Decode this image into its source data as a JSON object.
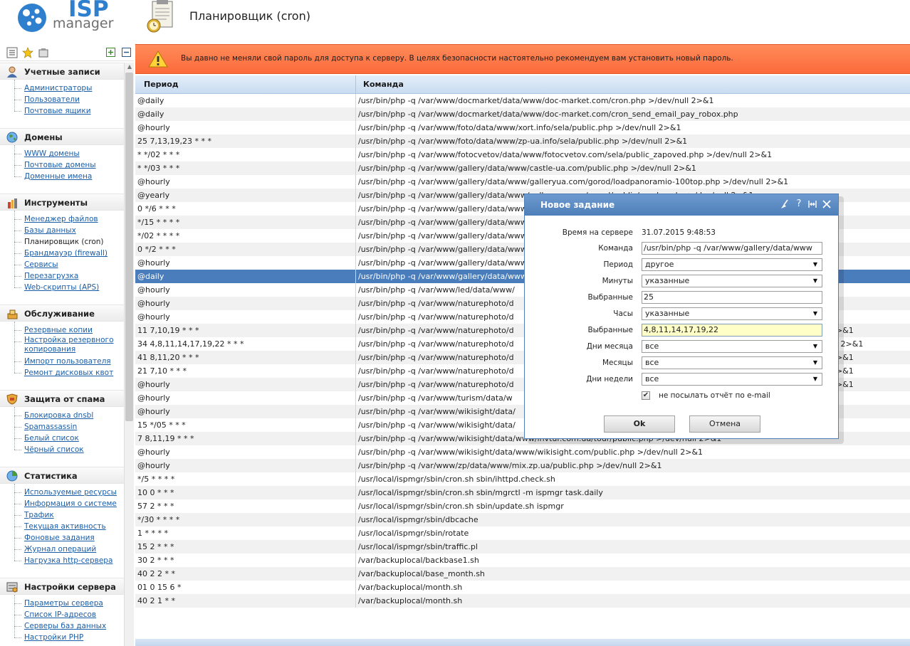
{
  "header": {
    "logo_isp": "ISP",
    "logo_manager": "manager",
    "page_title": "Планировщик (cron)"
  },
  "sidebar": {
    "toolbar": [
      "list-icon",
      "favorites-star-icon",
      "notes-icon",
      "expand-plus-icon",
      "collapse-minus-icon"
    ],
    "groups": [
      {
        "title": "Учетные записи",
        "icon": "users-icon",
        "items": [
          {
            "label": "Администраторы"
          },
          {
            "label": "Пользователи"
          },
          {
            "label": "Почтовые ящики"
          }
        ]
      },
      {
        "title": "Домены",
        "icon": "globe-icon",
        "items": [
          {
            "label": "WWW домены"
          },
          {
            "label": "Почтовые домены"
          },
          {
            "label": "Доменные имена"
          }
        ]
      },
      {
        "title": "Инструменты",
        "icon": "tools-icon",
        "items": [
          {
            "label": "Менеджер файлов"
          },
          {
            "label": "Базы данных"
          },
          {
            "label": "Планировщик (cron)"
          },
          {
            "label": "Брандмауэр (firewall)"
          },
          {
            "label": "Сервисы"
          },
          {
            "label": "Перезагрузка"
          },
          {
            "label": "Web-скрипты (APS)"
          }
        ]
      },
      {
        "title": "Обслуживание",
        "icon": "maintenance-icon",
        "items": [
          {
            "label": "Резервные копии"
          },
          {
            "label": "Настройка резервного копирования"
          },
          {
            "label": "Импорт пользователя"
          },
          {
            "label": "Ремонт дисковых квот"
          }
        ]
      },
      {
        "title": "Защита от спама",
        "icon": "shield-icon",
        "items": [
          {
            "label": "Блокировка dnsbl"
          },
          {
            "label": "Spamassassin"
          },
          {
            "label": "Белый список"
          },
          {
            "label": "Чёрный список"
          }
        ]
      },
      {
        "title": "Статистика",
        "icon": "chart-icon",
        "items": [
          {
            "label": "Используемые ресурсы"
          },
          {
            "label": "Информация о системе"
          },
          {
            "label": "Трафик"
          },
          {
            "label": "Текущая активность"
          },
          {
            "label": "Фоновые задания"
          },
          {
            "label": "Журнал операций"
          },
          {
            "label": "Нагрузка http-сервера"
          }
        ]
      },
      {
        "title": "Настройки сервера",
        "icon": "server-settings-icon",
        "items": [
          {
            "label": "Параметры сервера"
          },
          {
            "label": "Список IP-адресов"
          },
          {
            "label": "Серверы баз данных"
          },
          {
            "label": "Настройки PHP"
          }
        ]
      }
    ]
  },
  "warning": {
    "icon": "warning-icon",
    "text": "Вы давно не меняли свой пароль для доступа к серверу. В целях безопасности настоятельно рекомендуем вам установить новый пароль."
  },
  "table": {
    "columns": [
      "Период",
      "Команда"
    ],
    "rows": [
      {
        "period": "@daily",
        "command": "/usr/bin/php -q /var/www/docmarket/data/www/doc-market.com/cron.php >/dev/null 2>&1"
      },
      {
        "period": "@daily",
        "command": "/usr/bin/php -q /var/www/docmarket/data/www/doc-market.com/cron_send_email_pay_robox.php"
      },
      {
        "period": "@hourly",
        "command": "/usr/bin/php -q /var/www/foto/data/www/xort.info/sela/public.php >/dev/null 2>&1"
      },
      {
        "period": "25 7,13,19,23 * * *",
        "command": "/usr/bin/php -q /var/www/foto/data/www/zp-ua.info/sela/public.php >/dev/null 2>&1"
      },
      {
        "period": "* */02 * * *",
        "command": "/usr/bin/php -q /var/www/fotocvetov/data/www/fotocvetov.com/sela/public_zapoved.php >/dev/null 2>&1"
      },
      {
        "period": "* */03 * * *",
        "command": "/usr/bin/php -q /var/www/gallery/data/www/castle-ua.com/public.php >/dev/null 2>&1"
      },
      {
        "period": "@hourly",
        "command": "/usr/bin/php -q /var/www/gallery/data/www/galleryua.com/gorod/loadpanoramio-100top.php >/dev/null 2>&1"
      },
      {
        "period": "@yearly",
        "command": "/usr/bin/php -q /var/www/gallery/data/www/galleryua.com/gorod/public/yandex.php >/dev/null 2>&1"
      },
      {
        "period": "0 */6 * * *",
        "command": "/usr/bin/php -q /var/www/gallery/data/www"
      },
      {
        "period": "*/15 * * * *",
        "command": "/usr/bin/php -q /var/www/gallery/data/www"
      },
      {
        "period": "*/02 * * * *",
        "command": "/usr/bin/php -q /var/www/gallery/data/www"
      },
      {
        "period": "0 */2 * * *",
        "command": "/usr/bin/php -q /var/www/gallery/data/www"
      },
      {
        "period": "@hourly",
        "command": "/usr/bin/php -q /var/www/gallery/data/www"
      },
      {
        "period": "@daily",
        "command": "/usr/bin/php -q /var/www/gallery/data/www",
        "selected": true
      },
      {
        "period": "@hourly",
        "command": "/usr/bin/php -q /var/www/led/data/www/"
      },
      {
        "period": "@hourly",
        "command": "/usr/bin/php -q /var/www/naturephoto/d"
      },
      {
        "period": "@hourly",
        "command": "/usr/bin/php -q /var/www/naturephoto/d"
      },
      {
        "period": "11 7,10,19 * * *",
        "command": "/usr/bin/php -q /var/www/naturephoto/d",
        "tail": ">&1"
      },
      {
        "period": "34 4,8,11,14,17,19,22 * * *",
        "command": "/usr/bin/php -q /var/www/naturephoto/d",
        "tail": "l 2>&1"
      },
      {
        "period": "41 8,11,20 * * *",
        "command": "/usr/bin/php -q /var/www/naturephoto/d",
        "tail": ">&1"
      },
      {
        "period": "21 7,10 * * *",
        "command": "/usr/bin/php -q /var/www/naturephoto/d",
        "tail": ">&1"
      },
      {
        "period": "@hourly",
        "command": "/usr/bin/php -q /var/www/naturephoto/d",
        "tail": ">&1"
      },
      {
        "period": "@hourly",
        "command": "/usr/bin/php -q /var/www/turism/data/w"
      },
      {
        "period": "@hourly",
        "command": "/usr/bin/php -q /var/www/wikisight/data/"
      },
      {
        "period": "15 */05 * * *",
        "command": "/usr/bin/php -q /var/www/wikisight/data/"
      },
      {
        "period": "7 8,11,19 * * *",
        "command": "/usr/bin/php -q /var/www/wikisight/data/www/invtur.com.ua/tour/public.php >/dev/null 2>&1"
      },
      {
        "period": "@hourly",
        "command": "/usr/bin/php -q /var/www/wikisight/data/www/wikisight.com/public.php >/dev/null 2>&1"
      },
      {
        "period": "@hourly",
        "command": "/usr/bin/php -q /var/www/zp/data/www/mix.zp.ua/public.php >/dev/null 2>&1"
      },
      {
        "period": "*/5 * * * *",
        "command": "/usr/local/ispmgr/sbin/cron.sh sbin/ihttpd.check.sh"
      },
      {
        "period": "10 0 * * *",
        "command": "/usr/local/ispmgr/sbin/cron.sh sbin/mgrctl -m ispmgr task.daily"
      },
      {
        "period": "57 2 * * *",
        "command": "/usr/local/ispmgr/sbin/cron.sh sbin/update.sh ispmgr"
      },
      {
        "period": "*/30 * * * *",
        "command": "/usr/local/ispmgr/sbin/dbcache"
      },
      {
        "period": "1 * * * *",
        "command": "/usr/local/ispmgr/sbin/rotate"
      },
      {
        "period": "15 2 * * *",
        "command": "/usr/local/ispmgr/sbin/traffic.pl"
      },
      {
        "period": "30 2 * * *",
        "command": "/var/backuplocal/backbase1.sh"
      },
      {
        "period": "40 2 2 * *",
        "command": "/var/backuplocal/base_month.sh"
      },
      {
        "period": "01 0 15 6 *",
        "command": "/var/backuplocal/month.sh"
      },
      {
        "period": "40 2 1 * *",
        "command": "/var/backuplocal/month.sh"
      }
    ]
  },
  "modal": {
    "title": "Новое задание",
    "title_icons": [
      "broom-icon",
      "help-icon",
      "expand-icon",
      "close-icon"
    ],
    "fields": {
      "server_time_label": "Время на сервере",
      "server_time_value": "31.07.2015 9:48:53",
      "command_label": "Команда",
      "command_value": "/usr/bin/php -q /var/www/gallery/data/www",
      "period_label": "Период",
      "period_value": "другое",
      "minutes_label": "Минуты",
      "minutes_value": "указанные",
      "selected_minutes_label": "Выбранные",
      "selected_minutes_value": "25",
      "hours_label": "Часы",
      "hours_value": "указанные",
      "selected_hours_label": "Выбранные",
      "selected_hours_value": "4,8,11,14,17,19,22",
      "days_month_label": "Дни месяца",
      "days_month_value": "все",
      "months_label": "Месяцы",
      "months_value": "все",
      "weekdays_label": "Дни недели",
      "weekdays_value": "все",
      "no_email_label": "не посылать отчёт по e-mail",
      "no_email_checked": true
    },
    "ok_label": "Ok",
    "cancel_label": "Отмена"
  }
}
